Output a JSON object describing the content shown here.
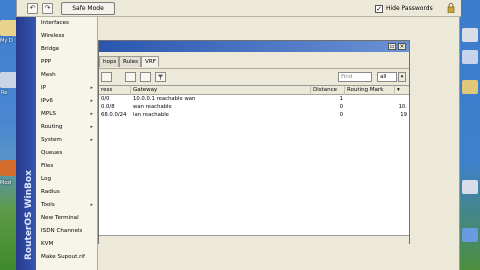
{
  "toolbar": {
    "undo_icon": "undo-icon",
    "redo_icon": "redo-icon",
    "safe_mode_label": "Safe Mode",
    "hide_passwords_label": "Hide Passwords",
    "hide_passwords_checked": "✓"
  },
  "brand": {
    "text": "RouterOS WinBox"
  },
  "menu": {
    "items": [
      {
        "label": "Interfaces",
        "arrow": ""
      },
      {
        "label": "Wireless",
        "arrow": ""
      },
      {
        "label": "Bridge",
        "arrow": ""
      },
      {
        "label": "PPP",
        "arrow": ""
      },
      {
        "label": "Mesh",
        "arrow": ""
      },
      {
        "label": "IP",
        "arrow": "▸"
      },
      {
        "label": "IPv6",
        "arrow": "▸"
      },
      {
        "label": "MPLS",
        "arrow": "▸"
      },
      {
        "label": "Routing",
        "arrow": "▸"
      },
      {
        "label": "System",
        "arrow": "▸"
      },
      {
        "label": "Queues",
        "arrow": ""
      },
      {
        "label": "Files",
        "arrow": ""
      },
      {
        "label": "Log",
        "arrow": ""
      },
      {
        "label": "Radius",
        "arrow": ""
      },
      {
        "label": "Tools",
        "arrow": "▸"
      },
      {
        "label": "New Terminal",
        "arrow": ""
      },
      {
        "label": "ISDN Channels",
        "arrow": ""
      },
      {
        "label": "KVM",
        "arrow": ""
      },
      {
        "label": "Make Supout.rif",
        "arrow": ""
      }
    ]
  },
  "route_window": {
    "tabs": [
      "hops",
      "Rules",
      "VRF"
    ],
    "find_placeholder": "Find",
    "filter_value": "all",
    "columns": [
      "ress",
      "Gateway",
      "Distance",
      "Routing Mark"
    ],
    "rows": [
      {
        "address": "0/0",
        "gateway": "10.0.0.1 reachable wan",
        "distance": "1",
        "mark": ""
      },
      {
        "address": "0.0/8",
        "gateway": "wan reachable",
        "distance": "0",
        "mark": "10."
      },
      {
        "address": "68.0.0/24",
        "gateway": "lan reachable",
        "distance": "0",
        "mark": "19"
      }
    ]
  },
  "desktop": {
    "left_labels": [
      "My D",
      "Re",
      "Mozi"
    ]
  }
}
